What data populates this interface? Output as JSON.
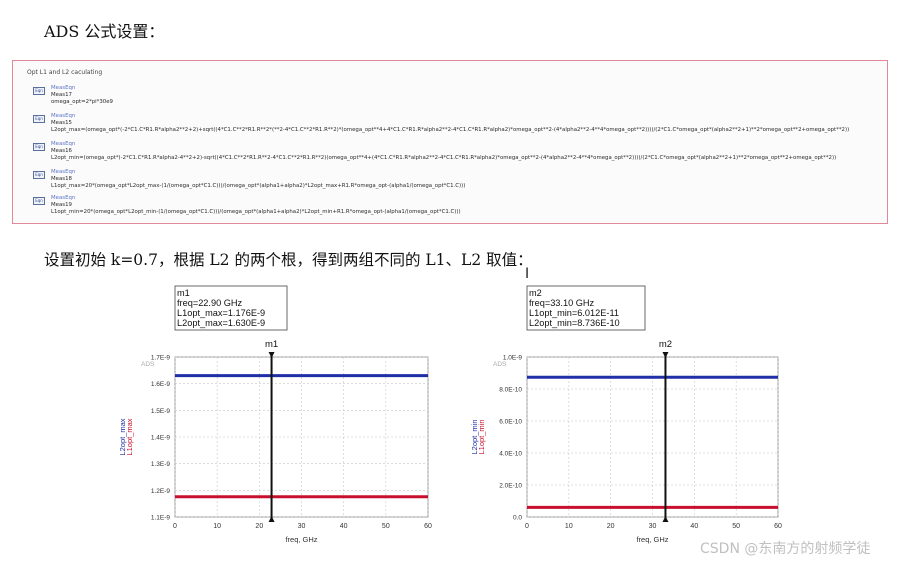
{
  "heading": "ADS 公式设置：",
  "panel": {
    "title": "Opt L1 and L2 caculating",
    "equations": [
      {
        "type": "MeasEqn",
        "name": "Meas17",
        "expr": "omega_opt=2*pi*30e9"
      },
      {
        "type": "MeasEqn",
        "name": "Meas15",
        "expr": "L2opt_max=(omega_opt*(-2*C1.C*R1.R*alpha2**2+2)+sqrt((4*C1.C**2*R1.R**2*(**2-4*C1.C**2*R1.R**2)*(omega_opt**4+4*C1.C*R1.R*alpha2**2-4*C1.C*R1.R*alpha2)*omega_opt**2-(4*alpha2**2-4**4*omega_opt**2))))/(2*C1.C*omega_opt*(alpha2**2+1)**2*omega_opt**2+omega_opt**2))"
      },
      {
        "type": "MeasEqn",
        "name": "Meas16",
        "expr": "L2opt_min=(omega_opt*(-2*C1.C*R1.R*alpha2-4**2+2)-sqrt((4*C1.C**2*R1.R**2-4*C1.C**2*R1.R**2)(omega_opt**4+(4*C1.C*R1.R*alpha2**2-4*C1.C*R1.R*alpha2)*omega_opt**2-(4*alpha2**2-4**4*omega_opt**2))))/(2*C1.C*omega_opt*(alpha2**2+1)**2*omega_opt**2+omega_opt**2))"
      },
      {
        "type": "MeasEqn",
        "name": "Meas18",
        "expr": "L1opt_max=20*(omega_opt*L2opt_max-(1/(omega_opt*C1.C)))/(omega_opt*(alpha1+alpha2)*L2opt_max+R1.R*omega_opt-(alpha1/(omega_opt*C1.C)))"
      },
      {
        "type": "MeasEqn",
        "name": "Meas19",
        "expr": "L1opt_min=20*(omega_opt*L2opt_min-(1/(omega_opt*C1.C)))/(omega_opt*(alpha1+alpha2)*L2opt_min+R1.R*omega_opt-(alpha1/(omega_opt*C1.C)))"
      }
    ]
  },
  "paragraph": "设置初始 k=0.7，根据 L2 的两个根，得到两组不同的 L1、L2 取值：",
  "watermark": "CSDN @东南方的射频学徒",
  "chart_data": [
    {
      "type": "line",
      "brand": "ADS",
      "marker": {
        "name": "m1",
        "x": 22.9,
        "lines": [
          "m1",
          "freq=22.90 GHz",
          "L1opt_max=1.176E-9",
          "L2opt_max=1.630E-9"
        ]
      },
      "xlabel": "freq, GHz",
      "xlim": [
        0,
        60
      ],
      "x_ticks": [
        0,
        10,
        20,
        30,
        40,
        50,
        60
      ],
      "ylim": [
        1.1e-09,
        1.7e-09
      ],
      "y_ticks": [
        1.1e-09,
        1.2e-09,
        1.3e-09,
        1.4e-09,
        1.5e-09,
        1.6e-09,
        1.7e-09
      ],
      "y_tick_labels": [
        "1.1E-9",
        "1.2E-9",
        "1.3E-9",
        "1.4E-9",
        "1.5E-9",
        "1.6E-9",
        "1.7E-9"
      ],
      "series": [
        {
          "name": "L2opt_max",
          "color": "#1f2fa8",
          "values": [
            1.63e-09,
            1.63e-09
          ]
        },
        {
          "name": "L1opt_max",
          "color": "#c8102e",
          "values": [
            1.176e-09,
            1.176e-09
          ]
        }
      ],
      "x": [
        0,
        60
      ],
      "grid": true
    },
    {
      "type": "line",
      "brand": "ADS",
      "marker": {
        "name": "m2",
        "x": 33.1,
        "lines": [
          "m2",
          "freq=33.10 GHz",
          "L1opt_min=6.012E-11",
          "L2opt_min=8.736E-10"
        ]
      },
      "xlabel": "freq, GHz",
      "xlim": [
        0,
        60
      ],
      "x_ticks": [
        0,
        10,
        20,
        30,
        40,
        50,
        60
      ],
      "ylim": [
        0,
        1e-09
      ],
      "y_ticks": [
        0,
        2e-10,
        4e-10,
        6e-10,
        8e-10,
        1e-09
      ],
      "y_tick_labels": [
        "0.0",
        "2.0E-10",
        "4.0E-10",
        "6.0E-10",
        "8.0E-10",
        "1.0E-9"
      ],
      "series": [
        {
          "name": "L2opt_min",
          "color": "#1f2fa8",
          "values": [
            8.736e-10,
            8.736e-10
          ]
        },
        {
          "name": "L1opt_min",
          "color": "#c8102e",
          "values": [
            6.012e-11,
            6.012e-11
          ]
        }
      ],
      "x": [
        0,
        60
      ],
      "grid": true
    }
  ]
}
